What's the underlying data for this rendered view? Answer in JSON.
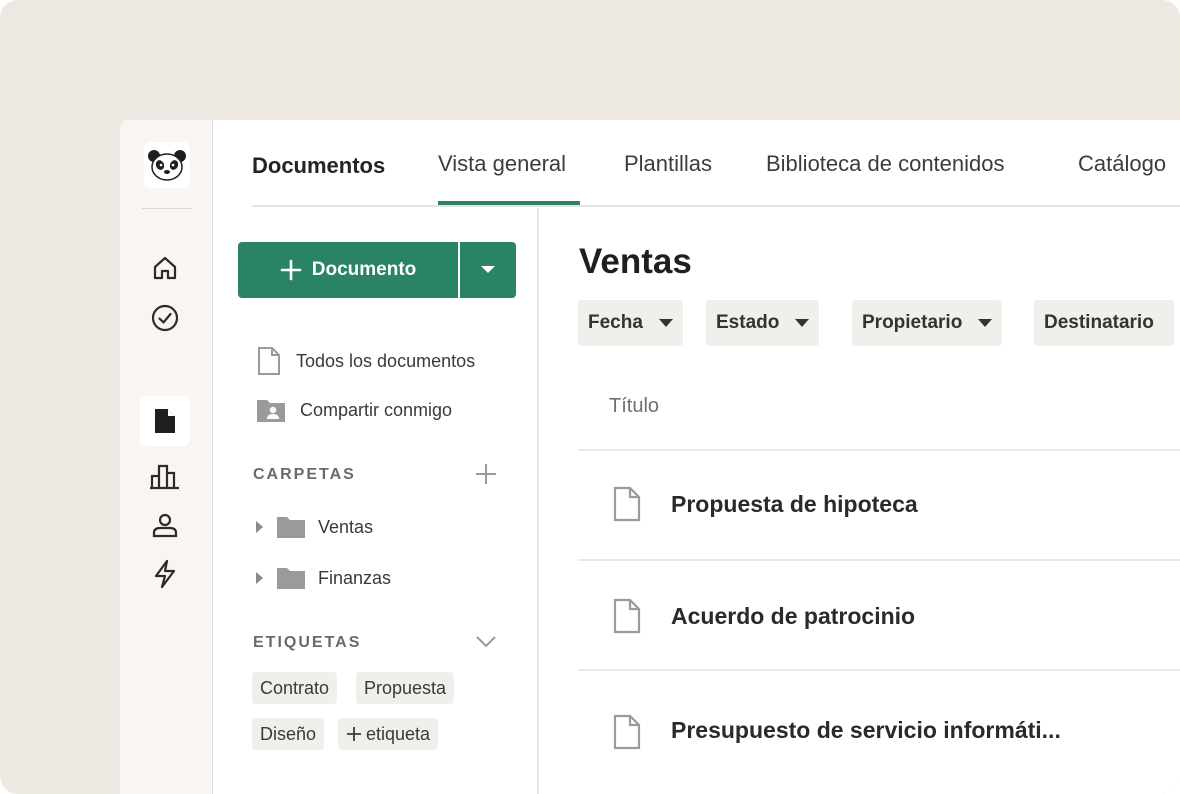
{
  "colors": {
    "accent": "#2a8363",
    "background": "#ede8e1",
    "rail": "#f8f5f2"
  },
  "rail": {
    "icons": [
      "panda-logo-icon",
      "home-icon",
      "check-circle-icon",
      "document-icon",
      "chart-icon",
      "person-icon",
      "lightning-icon"
    ],
    "active": "document-icon"
  },
  "tabs": {
    "title": "Documentos",
    "items": [
      {
        "label": "Vista general",
        "active": true
      },
      {
        "label": "Plantillas",
        "active": false
      },
      {
        "label": "Biblioteca de contenidos",
        "active": false
      },
      {
        "label": "Catálogo",
        "active": false
      }
    ]
  },
  "sidebar": {
    "new_button_label": "Documento",
    "nav": [
      {
        "label": "Todos los documentos",
        "icon": "document-outline-icon"
      },
      {
        "label": "Compartir conmigo",
        "icon": "shared-folder-icon"
      }
    ],
    "folders_label": "CARPETAS",
    "folders": [
      {
        "label": "Ventas"
      },
      {
        "label": "Finanzas"
      }
    ],
    "tags_label": "ETIQUETAS",
    "tags": [
      "Contrato",
      "Propuesta",
      "Diseño"
    ],
    "add_tag_label": "etiqueta"
  },
  "main": {
    "title": "Ventas",
    "filters": [
      "Fecha",
      "Estado",
      "Propietario",
      "Destinatario"
    ],
    "column_header": "Título",
    "rows": [
      {
        "title": "Propuesta de hipoteca"
      },
      {
        "title": "Acuerdo de patrocinio"
      },
      {
        "title": "Presupuesto de servicio informáti..."
      }
    ]
  }
}
